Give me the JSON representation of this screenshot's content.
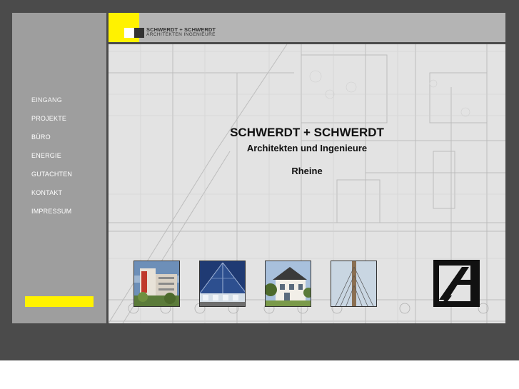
{
  "nav": {
    "items": [
      {
        "label": "EINGANG"
      },
      {
        "label": "PROJEKTE"
      },
      {
        "label": "BÜRO"
      },
      {
        "label": "ENERGIE"
      },
      {
        "label": "GUTACHTEN"
      },
      {
        "label": "KONTAKT"
      },
      {
        "label": "IMPRESSUM"
      }
    ]
  },
  "logo": {
    "line1": "SCHWERDT + SCHWERDT",
    "line2": "ARCHITEKTEN    INGENIEURE"
  },
  "main": {
    "title": "SCHWERDT + SCHWERDT",
    "subtitle": "Architekten und Ingenieure",
    "city": "Rheine"
  },
  "colors": {
    "accent_yellow": "#fff200",
    "page_background": "#4b4b4b",
    "sidebar": "#9e9e9e",
    "header": "#b4b4b4"
  },
  "icons": [
    "logo-squares-icon",
    "architect-emblem-icon"
  ]
}
